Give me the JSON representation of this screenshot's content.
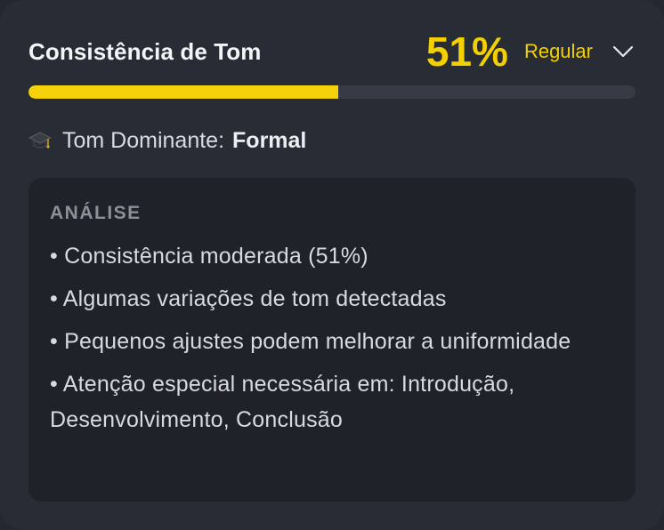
{
  "card": {
    "title": "Consistência de Tom",
    "score_text": "51%",
    "score_fraction": 0.51,
    "rating": "Regular",
    "accent_color": "#f5d000",
    "toggle_icon": "chevron-down-icon"
  },
  "dominant": {
    "icon": "graduation-cap-icon",
    "label": "Tom Dominante:",
    "value": "Formal"
  },
  "analysis": {
    "heading": "ANÁLISE",
    "items": [
      "• Consistência moderada (51%)",
      "• Algumas variações de tom detectadas",
      "• Pequenos ajustes podem melhorar a uniformidade",
      "• Atenção especial necessária em: Introdução, Desenvolvimento, Conclusão"
    ]
  }
}
